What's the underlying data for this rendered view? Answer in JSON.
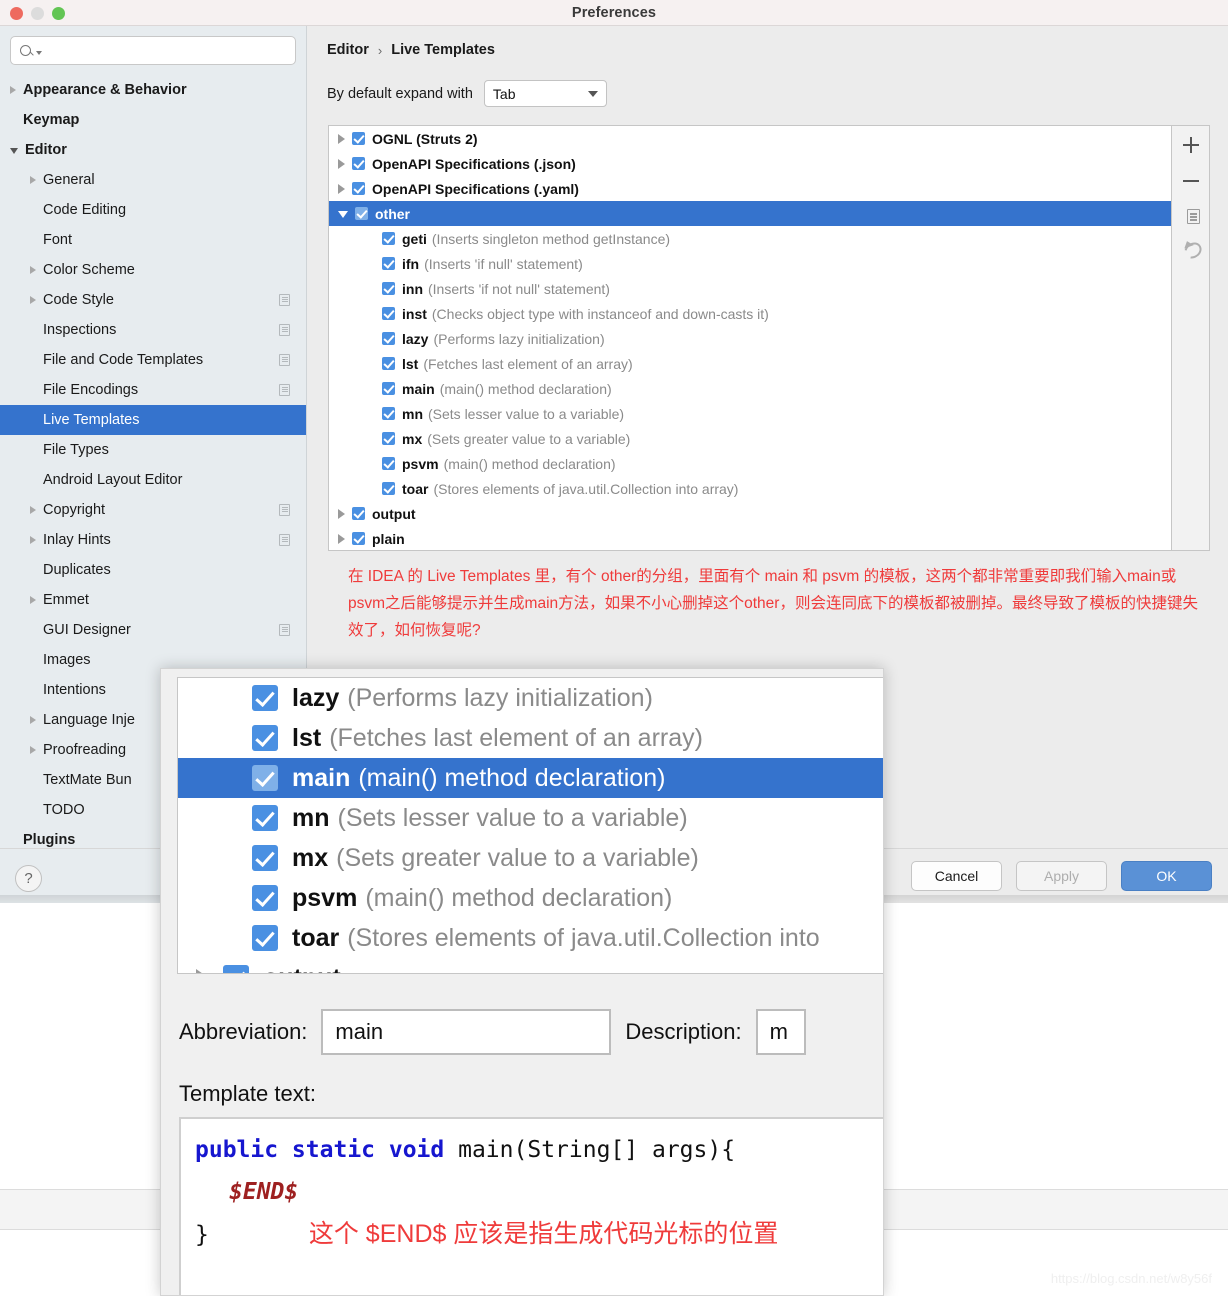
{
  "window": {
    "title": "Preferences",
    "traffic_lights": [
      "close-red",
      "minimize-gray",
      "zoom-green"
    ]
  },
  "sidebar": {
    "search": {
      "value": "",
      "placeholder": ""
    },
    "items": [
      {
        "label": "Appearance & Behavior",
        "arrow": "right",
        "bold": true,
        "indent": 0,
        "badge": false,
        "selected": false
      },
      {
        "label": "Keymap",
        "arrow": "none",
        "bold": true,
        "indent": 0,
        "badge": false,
        "selected": false
      },
      {
        "label": "Editor",
        "arrow": "down",
        "bold": true,
        "indent": 0,
        "badge": false,
        "selected": false
      },
      {
        "label": "General",
        "arrow": "right",
        "bold": false,
        "indent": 1,
        "badge": false,
        "selected": false
      },
      {
        "label": "Code Editing",
        "arrow": "none",
        "bold": false,
        "indent": 1,
        "badge": false,
        "selected": false
      },
      {
        "label": "Font",
        "arrow": "none",
        "bold": false,
        "indent": 1,
        "badge": false,
        "selected": false
      },
      {
        "label": "Color Scheme",
        "arrow": "right",
        "bold": false,
        "indent": 1,
        "badge": false,
        "selected": false
      },
      {
        "label": "Code Style",
        "arrow": "right",
        "bold": false,
        "indent": 1,
        "badge": true,
        "selected": false
      },
      {
        "label": "Inspections",
        "arrow": "none",
        "bold": false,
        "indent": 1,
        "badge": true,
        "selected": false
      },
      {
        "label": "File and Code Templates",
        "arrow": "none",
        "bold": false,
        "indent": 1,
        "badge": true,
        "selected": false
      },
      {
        "label": "File Encodings",
        "arrow": "none",
        "bold": false,
        "indent": 1,
        "badge": true,
        "selected": false
      },
      {
        "label": "Live Templates",
        "arrow": "none",
        "bold": false,
        "indent": 1,
        "badge": false,
        "selected": true
      },
      {
        "label": "File Types",
        "arrow": "none",
        "bold": false,
        "indent": 1,
        "badge": false,
        "selected": false
      },
      {
        "label": "Android Layout Editor",
        "arrow": "none",
        "bold": false,
        "indent": 1,
        "badge": false,
        "selected": false
      },
      {
        "label": "Copyright",
        "arrow": "right",
        "bold": false,
        "indent": 1,
        "badge": true,
        "selected": false
      },
      {
        "label": "Inlay Hints",
        "arrow": "right",
        "bold": false,
        "indent": 1,
        "badge": true,
        "selected": false
      },
      {
        "label": "Duplicates",
        "arrow": "none",
        "bold": false,
        "indent": 1,
        "badge": false,
        "selected": false
      },
      {
        "label": "Emmet",
        "arrow": "right",
        "bold": false,
        "indent": 1,
        "badge": false,
        "selected": false
      },
      {
        "label": "GUI Designer",
        "arrow": "none",
        "bold": false,
        "indent": 1,
        "badge": true,
        "selected": false
      },
      {
        "label": "Images",
        "arrow": "none",
        "bold": false,
        "indent": 1,
        "badge": false,
        "selected": false
      },
      {
        "label": "Intentions",
        "arrow": "none",
        "bold": false,
        "indent": 1,
        "badge": false,
        "selected": false
      },
      {
        "label": "Language Inje",
        "arrow": "right",
        "bold": false,
        "indent": 1,
        "badge": false,
        "selected": false
      },
      {
        "label": "Proofreading",
        "arrow": "right",
        "bold": false,
        "indent": 1,
        "badge": false,
        "selected": false
      },
      {
        "label": "TextMate Bun",
        "arrow": "none",
        "bold": false,
        "indent": 1,
        "badge": false,
        "selected": false
      },
      {
        "label": "TODO",
        "arrow": "none",
        "bold": false,
        "indent": 1,
        "badge": false,
        "selected": false
      },
      {
        "label": "Plugins",
        "arrow": "none",
        "bold": true,
        "indent": 0,
        "badge": false,
        "selected": false
      }
    ]
  },
  "main": {
    "breadcrumb": {
      "parent": "Editor",
      "separator": "›",
      "current": "Live Templates"
    },
    "expand_with": {
      "label": "By default expand with",
      "value": "Tab"
    },
    "templates": [
      {
        "name": "OGNL (Struts 2)",
        "desc": "",
        "arrow": "right",
        "group": true,
        "checked": true,
        "selected": false
      },
      {
        "name": "OpenAPI Specifications (.json)",
        "desc": "",
        "arrow": "right",
        "group": true,
        "checked": true,
        "selected": false
      },
      {
        "name": "OpenAPI Specifications (.yaml)",
        "desc": "",
        "arrow": "right",
        "group": true,
        "checked": true,
        "selected": false
      },
      {
        "name": "other",
        "desc": "",
        "arrow": "down",
        "group": true,
        "checked": true,
        "selected": true
      },
      {
        "name": "geti",
        "desc": "(Inserts singleton method getInstance)",
        "arrow": "",
        "group": false,
        "checked": true,
        "selected": false
      },
      {
        "name": "ifn",
        "desc": "(Inserts 'if null' statement)",
        "arrow": "",
        "group": false,
        "checked": true,
        "selected": false
      },
      {
        "name": "inn",
        "desc": "(Inserts 'if not null' statement)",
        "arrow": "",
        "group": false,
        "checked": true,
        "selected": false
      },
      {
        "name": "inst",
        "desc": "(Checks object type with instanceof and down-casts it)",
        "arrow": "",
        "group": false,
        "checked": true,
        "selected": false
      },
      {
        "name": "lazy",
        "desc": "(Performs lazy initialization)",
        "arrow": "",
        "group": false,
        "checked": true,
        "selected": false
      },
      {
        "name": "lst",
        "desc": "(Fetches last element of an array)",
        "arrow": "",
        "group": false,
        "checked": true,
        "selected": false
      },
      {
        "name": "main",
        "desc": "(main() method declaration)",
        "arrow": "",
        "group": false,
        "checked": true,
        "selected": false
      },
      {
        "name": "mn",
        "desc": "(Sets lesser value to a variable)",
        "arrow": "",
        "group": false,
        "checked": true,
        "selected": false
      },
      {
        "name": "mx",
        "desc": "(Sets greater value to a variable)",
        "arrow": "",
        "group": false,
        "checked": true,
        "selected": false
      },
      {
        "name": "psvm",
        "desc": "(main() method declaration)",
        "arrow": "",
        "group": false,
        "checked": true,
        "selected": false
      },
      {
        "name": "toar",
        "desc": "(Stores elements of java.util.Collection into array)",
        "arrow": "",
        "group": false,
        "checked": true,
        "selected": false
      },
      {
        "name": "output",
        "desc": "",
        "arrow": "right",
        "group": true,
        "checked": true,
        "selected": false
      },
      {
        "name": "plain",
        "desc": "",
        "arrow": "right",
        "group": true,
        "checked": true,
        "selected": false
      }
    ],
    "toolbar": {
      "add": "+",
      "remove": "−",
      "duplicate": "copy-icon",
      "revert": "undo-icon"
    },
    "annotation_red": "在 IDEA 的 Live Templates 里，有个 other的分组，里面有个 main 和 psvm 的模板，这两个都非常重要即我们输入main或psvm之后能够提示并生成main方法，如果不小心删掉这个other，则会连同底下的模板都被删掉。最终导致了模板的快捷键失效了，如何恢复呢?"
  },
  "footer": {
    "help": "?",
    "cancel": "Cancel",
    "apply": "Apply",
    "ok": "OK"
  },
  "overlay": {
    "rows": [
      {
        "name": "lazy",
        "desc": "(Performs lazy initialization)",
        "selected": false,
        "group": false
      },
      {
        "name": "lst",
        "desc": "(Fetches last element of an array)",
        "selected": false,
        "group": false
      },
      {
        "name": "main",
        "desc": "(main() method declaration)",
        "selected": true,
        "group": false
      },
      {
        "name": "mn",
        "desc": "(Sets lesser value to a variable)",
        "selected": false,
        "group": false
      },
      {
        "name": "mx",
        "desc": "(Sets greater value to a variable)",
        "selected": false,
        "group": false
      },
      {
        "name": "psvm",
        "desc": "(main() method declaration)",
        "selected": false,
        "group": false
      },
      {
        "name": "toar",
        "desc": "(Stores elements of java.util.Collection into",
        "selected": false,
        "group": false
      },
      {
        "name": "output",
        "desc": "",
        "selected": false,
        "group": true
      }
    ],
    "abbreviation_label": "Abbreviation:",
    "abbreviation_value": "main",
    "description_label": "Description:",
    "description_value": "m",
    "template_text_label": "Template text:",
    "code": {
      "keywords": "public static void ",
      "signature": "main(String[] args){",
      "end_var": "$END$",
      "closing": "}"
    },
    "code_note": "这个 $END$ 应该是指生成代码光标的位置"
  },
  "watermark": "https://blog.csdn.net/w8y56f"
}
